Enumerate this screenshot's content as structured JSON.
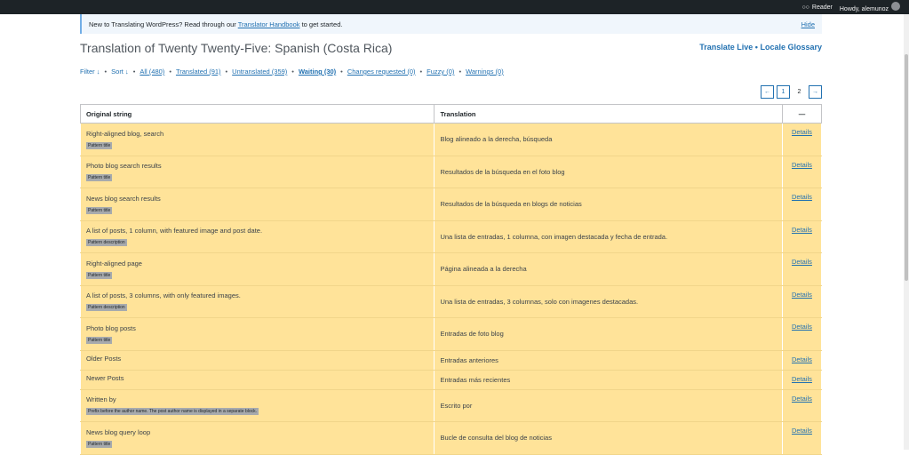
{
  "adminbar": {
    "reader": "Reader",
    "howdy": "Howdy, alemunoz"
  },
  "notice": {
    "text_before": "New to Translating WordPress? Read through our ",
    "link": "Translator Handbook",
    "text_after": " to get started.",
    "hide": "Hide"
  },
  "page": {
    "title": "Translation of Twenty Twenty-Five: Spanish (Costa Rica)",
    "translate_live": "Translate Live",
    "separator": "•",
    "locale_glossary": "Locale Glossary"
  },
  "filters": {
    "filter": "Filter ↓",
    "sort": "Sort ↓",
    "all": "All (480)",
    "translated": "Translated (91)",
    "untranslated": "Untranslated (359)",
    "waiting": "Waiting (30)",
    "changes": "Changes requested (0)",
    "fuzzy": "Fuzzy (0)",
    "warnings": "Warnings (0)",
    "dot": "•"
  },
  "pager": {
    "prev": "←",
    "page1": "1",
    "page2": "2",
    "next": "→"
  },
  "table": {
    "headers": {
      "original": "Original string",
      "translation": "Translation",
      "actions": "—"
    },
    "details": "Details",
    "rows": [
      {
        "original": "Right-aligned blog, search",
        "badge": "Pattern title",
        "translation": "Blog alineado a la derecha, búsqueda"
      },
      {
        "original": "Photo blog search results",
        "badge": "Pattern title",
        "translation": "Resultados de la búsqueda en el foto blog"
      },
      {
        "original": "News blog search results",
        "badge": "Pattern title",
        "translation": "Resultados de la búsqueda en blogs de noticias"
      },
      {
        "original": "A list of posts, 1 column, with featured image and post date.",
        "badge": "Pattern description",
        "translation": "Una lista de entradas, 1 columna, con imagen destacada y fecha de entrada."
      },
      {
        "original": "Right-aligned page",
        "badge": "Pattern title",
        "translation": "Página alineada a la derecha"
      },
      {
        "original": "A list of posts, 3 columns, with only featured images.",
        "badge": "Pattern description",
        "translation": "Una lista de entradas, 3 columnas, solo con imagenes destacadas."
      },
      {
        "original": "Photo blog posts",
        "badge": "Pattern title",
        "translation": "Entradas de foto blog"
      },
      {
        "original": "Older Posts",
        "badge": "",
        "translation": "Entradas anteriores"
      },
      {
        "original": "Newer Posts",
        "badge": "",
        "translation": "Entradas más recientes"
      },
      {
        "original": "Written by",
        "badge": "Prefix before the author name. The post author name is displayed in a separate block.",
        "translation": "Escrito por"
      },
      {
        "original": "News blog query loop",
        "badge": "Pattern title",
        "translation": "Bucle de consulta del blog de noticias"
      }
    ]
  }
}
